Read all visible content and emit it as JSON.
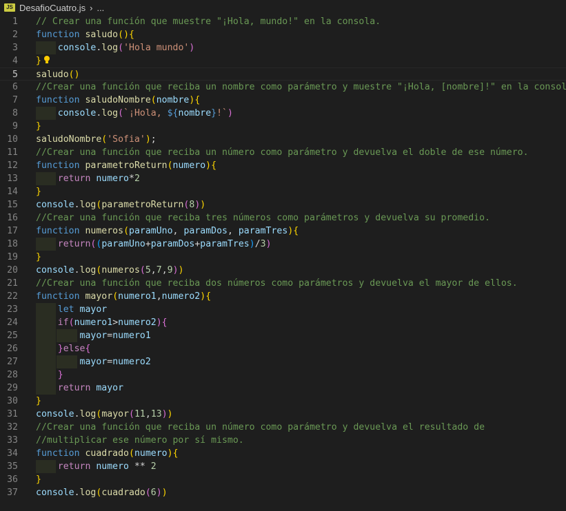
{
  "breadcrumb": {
    "file_icon_text": "JS",
    "file_name": "DesafioCuatro.js",
    "separator": "›",
    "ellipsis": "..."
  },
  "colors": {
    "comment": "#6a9955",
    "keyword": "#569cd6",
    "control": "#c586c0",
    "function": "#dcdcaa",
    "variable": "#9cdcfe",
    "string": "#ce9178",
    "number": "#b5cea8",
    "plain": "#d4d4d4",
    "bracket1": "#ffd700",
    "bracket2": "#da70d6",
    "bracket3": "#179fff"
  },
  "active_line": 5,
  "lightbulb_line": 4,
  "lines": [
    {
      "n": "1",
      "indent": [],
      "tokens": [
        [
          "// Crear una función que muestre \"¡Hola, mundo!\" en la consola.",
          "comment"
        ]
      ]
    },
    {
      "n": "2",
      "indent": [],
      "tokens": [
        [
          "function",
          "keyword"
        ],
        [
          " ",
          "plain"
        ],
        [
          "saludo",
          "function"
        ],
        [
          "()",
          "bracket1"
        ],
        [
          "{",
          "bracket1"
        ]
      ]
    },
    {
      "n": "3",
      "indent": [
        1
      ],
      "tokens": [
        [
          "    ",
          "plain"
        ],
        [
          "console",
          "variable"
        ],
        [
          ".",
          "plain"
        ],
        [
          "log",
          "function"
        ],
        [
          "(",
          "bracket2"
        ],
        [
          "'Hola mundo'",
          "string"
        ],
        [
          ")",
          "bracket2"
        ]
      ]
    },
    {
      "n": "4",
      "indent": [],
      "tokens": [
        [
          "}",
          "bracket1"
        ]
      ]
    },
    {
      "n": "5",
      "indent": [],
      "tokens": [
        [
          "saludo",
          "function"
        ],
        [
          "()",
          "bracket1"
        ]
      ]
    },
    {
      "n": "6",
      "indent": [],
      "tokens": [
        [
          "//Crear una función que reciba un nombre como parámetro y muestre \"¡Hola, [nombre]!\" en la consola.",
          "comment"
        ]
      ]
    },
    {
      "n": "7",
      "indent": [],
      "tokens": [
        [
          "function",
          "keyword"
        ],
        [
          " ",
          "plain"
        ],
        [
          "saludoNombre",
          "function"
        ],
        [
          "(",
          "bracket1"
        ],
        [
          "nombre",
          "variable"
        ],
        [
          ")",
          "bracket1"
        ],
        [
          "{",
          "bracket1"
        ]
      ]
    },
    {
      "n": "8",
      "indent": [
        1
      ],
      "tokens": [
        [
          "    ",
          "plain"
        ],
        [
          "console",
          "variable"
        ],
        [
          ".",
          "plain"
        ],
        [
          "log",
          "function"
        ],
        [
          "(",
          "bracket2"
        ],
        [
          "`¡Hola, ",
          "string"
        ],
        [
          "${",
          "keyword"
        ],
        [
          "nombre",
          "variable"
        ],
        [
          "}",
          "keyword"
        ],
        [
          "!`",
          "string"
        ],
        [
          ")",
          "bracket2"
        ]
      ]
    },
    {
      "n": "9",
      "indent": [],
      "tokens": [
        [
          "}",
          "bracket1"
        ]
      ]
    },
    {
      "n": "10",
      "indent": [],
      "tokens": [
        [
          "saludoNombre",
          "function"
        ],
        [
          "(",
          "bracket1"
        ],
        [
          "'Sofia'",
          "string"
        ],
        [
          ")",
          "bracket1"
        ],
        [
          ";",
          "plain"
        ]
      ]
    },
    {
      "n": "11",
      "indent": [],
      "tokens": [
        [
          "//Crear una función que reciba un número como parámetro y devuelva el doble de ese número.",
          "comment"
        ]
      ]
    },
    {
      "n": "12",
      "indent": [],
      "tokens": [
        [
          "function",
          "keyword"
        ],
        [
          " ",
          "plain"
        ],
        [
          "parametroReturn",
          "function"
        ],
        [
          "(",
          "bracket1"
        ],
        [
          "numero",
          "variable"
        ],
        [
          ")",
          "bracket1"
        ],
        [
          "{",
          "bracket1"
        ]
      ]
    },
    {
      "n": "13",
      "indent": [
        1
      ],
      "tokens": [
        [
          "    ",
          "plain"
        ],
        [
          "return",
          "control"
        ],
        [
          " ",
          "plain"
        ],
        [
          "numero",
          "variable"
        ],
        [
          "*",
          "plain"
        ],
        [
          "2",
          "number"
        ]
      ]
    },
    {
      "n": "14",
      "indent": [],
      "tokens": [
        [
          "}",
          "bracket1"
        ]
      ]
    },
    {
      "n": "15",
      "indent": [],
      "tokens": [
        [
          "console",
          "variable"
        ],
        [
          ".",
          "plain"
        ],
        [
          "log",
          "function"
        ],
        [
          "(",
          "bracket1"
        ],
        [
          "parametroReturn",
          "function"
        ],
        [
          "(",
          "bracket2"
        ],
        [
          "8",
          "number"
        ],
        [
          ")",
          "bracket2"
        ],
        [
          ")",
          "bracket1"
        ]
      ]
    },
    {
      "n": "16",
      "indent": [],
      "tokens": [
        [
          "//Crear una función que reciba tres números como parámetros y devuelva su promedio.",
          "comment"
        ]
      ]
    },
    {
      "n": "17",
      "indent": [],
      "tokens": [
        [
          "function",
          "keyword"
        ],
        [
          " ",
          "plain"
        ],
        [
          "numeros",
          "function"
        ],
        [
          "(",
          "bracket1"
        ],
        [
          "paramUno",
          "variable"
        ],
        [
          ", ",
          "plain"
        ],
        [
          "paramDos",
          "variable"
        ],
        [
          ", ",
          "plain"
        ],
        [
          "paramTres",
          "variable"
        ],
        [
          ")",
          "bracket1"
        ],
        [
          "{",
          "bracket1"
        ]
      ]
    },
    {
      "n": "18",
      "indent": [
        1
      ],
      "tokens": [
        [
          "    ",
          "plain"
        ],
        [
          "return",
          "control"
        ],
        [
          "(",
          "bracket2"
        ],
        [
          "(",
          "bracket3"
        ],
        [
          "paramUno",
          "variable"
        ],
        [
          "+",
          "plain"
        ],
        [
          "paramDos",
          "variable"
        ],
        [
          "+",
          "plain"
        ],
        [
          "paramTres",
          "variable"
        ],
        [
          ")",
          "bracket3"
        ],
        [
          "/",
          "plain"
        ],
        [
          "3",
          "number"
        ],
        [
          ")",
          "bracket2"
        ]
      ]
    },
    {
      "n": "19",
      "indent": [],
      "tokens": [
        [
          "}",
          "bracket1"
        ]
      ]
    },
    {
      "n": "20",
      "indent": [],
      "tokens": [
        [
          "console",
          "variable"
        ],
        [
          ".",
          "plain"
        ],
        [
          "log",
          "function"
        ],
        [
          "(",
          "bracket1"
        ],
        [
          "numeros",
          "function"
        ],
        [
          "(",
          "bracket2"
        ],
        [
          "5",
          "number"
        ],
        [
          ",",
          "plain"
        ],
        [
          "7",
          "number"
        ],
        [
          ",",
          "plain"
        ],
        [
          "9",
          "number"
        ],
        [
          ")",
          "bracket2"
        ],
        [
          ")",
          "bracket1"
        ]
      ]
    },
    {
      "n": "21",
      "indent": [],
      "tokens": [
        [
          "//Crear una función que reciba dos números como parámetros y devuelva el mayor de ellos.",
          "comment"
        ]
      ]
    },
    {
      "n": "22",
      "indent": [],
      "tokens": [
        [
          "function",
          "keyword"
        ],
        [
          " ",
          "plain"
        ],
        [
          "mayor",
          "function"
        ],
        [
          "(",
          "bracket1"
        ],
        [
          "numero1",
          "variable"
        ],
        [
          ",",
          "plain"
        ],
        [
          "numero2",
          "variable"
        ],
        [
          ")",
          "bracket1"
        ],
        [
          "{",
          "bracket1"
        ]
      ]
    },
    {
      "n": "23",
      "indent": [
        1
      ],
      "tokens": [
        [
          "    ",
          "plain"
        ],
        [
          "let",
          "keyword"
        ],
        [
          " ",
          "plain"
        ],
        [
          "mayor",
          "variable"
        ]
      ]
    },
    {
      "n": "24",
      "indent": [
        1
      ],
      "tokens": [
        [
          "    ",
          "plain"
        ],
        [
          "if",
          "control"
        ],
        [
          "(",
          "bracket2"
        ],
        [
          "numero1",
          "variable"
        ],
        [
          ">",
          "plain"
        ],
        [
          "numero2",
          "variable"
        ],
        [
          ")",
          "bracket2"
        ],
        [
          "{",
          "bracket2"
        ]
      ]
    },
    {
      "n": "25",
      "indent": [
        1,
        2
      ],
      "tokens": [
        [
          "        ",
          "plain"
        ],
        [
          "mayor",
          "variable"
        ],
        [
          "=",
          "plain"
        ],
        [
          "numero1",
          "variable"
        ]
      ]
    },
    {
      "n": "26",
      "indent": [
        1
      ],
      "tokens": [
        [
          "    ",
          "plain"
        ],
        [
          "}",
          "bracket2"
        ],
        [
          "else",
          "control"
        ],
        [
          "{",
          "bracket2"
        ]
      ]
    },
    {
      "n": "27",
      "indent": [
        1,
        2
      ],
      "tokens": [
        [
          "        ",
          "plain"
        ],
        [
          "mayor",
          "variable"
        ],
        [
          "=",
          "plain"
        ],
        [
          "numero2",
          "variable"
        ]
      ]
    },
    {
      "n": "28",
      "indent": [
        1
      ],
      "tokens": [
        [
          "    ",
          "plain"
        ],
        [
          "}",
          "bracket2"
        ]
      ]
    },
    {
      "n": "29",
      "indent": [
        1
      ],
      "tokens": [
        [
          "    ",
          "plain"
        ],
        [
          "return",
          "control"
        ],
        [
          " ",
          "plain"
        ],
        [
          "mayor",
          "variable"
        ]
      ]
    },
    {
      "n": "30",
      "indent": [],
      "tokens": [
        [
          "}",
          "bracket1"
        ]
      ]
    },
    {
      "n": "31",
      "indent": [],
      "tokens": [
        [
          "console",
          "variable"
        ],
        [
          ".",
          "plain"
        ],
        [
          "log",
          "function"
        ],
        [
          "(",
          "bracket1"
        ],
        [
          "mayor",
          "function"
        ],
        [
          "(",
          "bracket2"
        ],
        [
          "11",
          "number"
        ],
        [
          ",",
          "plain"
        ],
        [
          "13",
          "number"
        ],
        [
          ")",
          "bracket2"
        ],
        [
          ")",
          "bracket1"
        ]
      ]
    },
    {
      "n": "32",
      "indent": [],
      "tokens": [
        [
          "//Crear una función que reciba un número como parámetro y devuelva el resultado de",
          "comment"
        ]
      ]
    },
    {
      "n": "33",
      "indent": [],
      "tokens": [
        [
          "//multiplicar ese número por sí mismo.",
          "comment"
        ]
      ]
    },
    {
      "n": "34",
      "indent": [],
      "tokens": [
        [
          "function",
          "keyword"
        ],
        [
          " ",
          "plain"
        ],
        [
          "cuadrado",
          "function"
        ],
        [
          "(",
          "bracket1"
        ],
        [
          "numero",
          "variable"
        ],
        [
          ")",
          "bracket1"
        ],
        [
          "{",
          "bracket1"
        ]
      ]
    },
    {
      "n": "35",
      "indent": [
        1
      ],
      "tokens": [
        [
          "    ",
          "plain"
        ],
        [
          "return",
          "control"
        ],
        [
          " ",
          "plain"
        ],
        [
          "numero",
          "variable"
        ],
        [
          " ** ",
          "plain"
        ],
        [
          "2",
          "number"
        ]
      ]
    },
    {
      "n": "36",
      "indent": [],
      "tokens": [
        [
          "}",
          "bracket1"
        ]
      ]
    },
    {
      "n": "37",
      "indent": [],
      "tokens": [
        [
          "console",
          "variable"
        ],
        [
          ".",
          "plain"
        ],
        [
          "log",
          "function"
        ],
        [
          "(",
          "bracket1"
        ],
        [
          "cuadrado",
          "function"
        ],
        [
          "(",
          "bracket2"
        ],
        [
          "6",
          "number"
        ],
        [
          ")",
          "bracket2"
        ],
        [
          ")",
          "bracket1"
        ]
      ]
    }
  ]
}
